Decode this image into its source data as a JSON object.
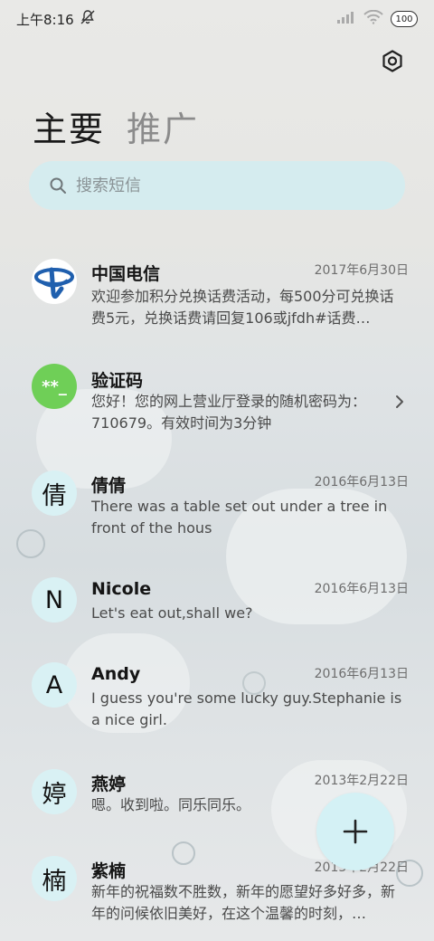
{
  "status_bar": {
    "time": "上午8:16",
    "battery": "100"
  },
  "tabs": [
    {
      "label": "主要"
    },
    {
      "label": "推广"
    }
  ],
  "search": {
    "placeholder": "搜索短信"
  },
  "messages": [
    {
      "avatar_text": "",
      "avatar_icon": "china-telecom-logo",
      "name": "中国电信",
      "date": "2017年6月30日",
      "preview": "欢迎参加积分兑换话费活动，每500分可兑换话费5元，兑换话费请回复106或jfdh#话费…"
    },
    {
      "avatar_text": "**_",
      "name": "验证码",
      "date": "",
      "preview": "您好！您的网上营业厅登录的随机密码为：710679。有效时间为3分钟"
    },
    {
      "avatar_text": "倩",
      "name": "倩倩",
      "date": "2016年6月13日",
      "preview": "There was a table set out under a tree in front of the hous"
    },
    {
      "avatar_text": "N",
      "name": "Nicole",
      "date": "2016年6月13日",
      "preview": "Let's eat out,shall we?"
    },
    {
      "avatar_text": "A",
      "name": "Andy",
      "date": "2016年6月13日",
      "preview": "I guess you're some lucky guy.Stephanie is a nice girl."
    },
    {
      "avatar_text": "婷",
      "name": "燕婷",
      "date": "2013年2月22日",
      "preview": "嗯。收到啦。同乐同乐。"
    },
    {
      "avatar_text": "楠",
      "name": "紫楠",
      "date": "2013年2月22日",
      "preview": "新年的祝福数不胜数，新年的愿望好多好多，新年的问候依旧美好，在这个温馨的时刻，…"
    }
  ],
  "colors": {
    "avatar_bg": "#d9f1f4",
    "verification_avatar": "#6fcf57",
    "telecom_blue": "#1f5fae",
    "search_bg": "#d5ecef",
    "fab_bg": "#d4f1f5"
  },
  "icons": {
    "settings": "gear-icon",
    "search": "search-icon",
    "fab": "plus-icon",
    "chevron": "chevron-right-icon"
  }
}
